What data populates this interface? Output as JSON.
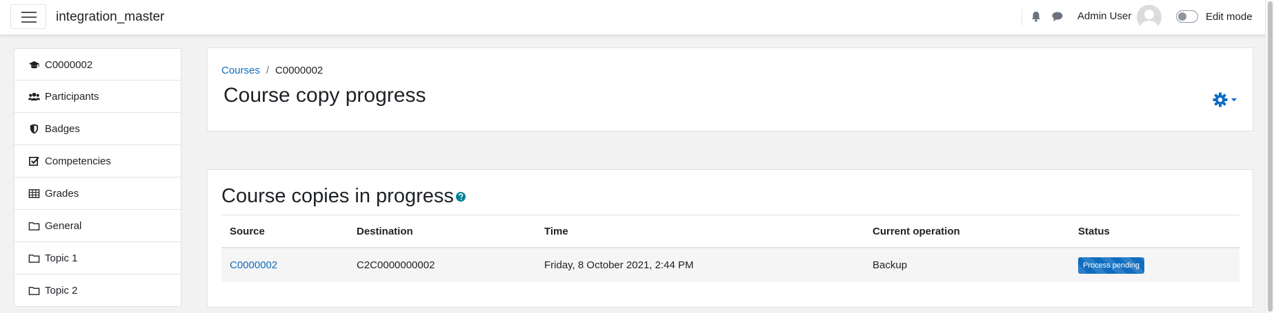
{
  "navbar": {
    "site_name": "integration_master",
    "user_name": "Admin User",
    "edit_mode_label": "Edit mode",
    "icons": [
      "bell-icon",
      "chat-icon"
    ]
  },
  "sidebar": {
    "items": [
      {
        "label": "C0000002",
        "icon": "graduation-cap-icon"
      },
      {
        "label": "Participants",
        "icon": "users-icon"
      },
      {
        "label": "Badges",
        "icon": "shield-icon"
      },
      {
        "label": "Competencies",
        "icon": "checkbox-icon"
      },
      {
        "label": "Grades",
        "icon": "table-icon"
      },
      {
        "label": "General",
        "icon": "folder-icon"
      },
      {
        "label": "Topic 1",
        "icon": "folder-icon"
      },
      {
        "label": "Topic 2",
        "icon": "folder-icon"
      }
    ]
  },
  "header": {
    "breadcrumb": [
      "Courses",
      "C0000002"
    ],
    "title": "Course copy progress"
  },
  "copies": {
    "title": "Course copies in progress",
    "columns": [
      "Source",
      "Destination",
      "Time",
      "Current operation",
      "Status"
    ],
    "rows": [
      {
        "source": "C0000002",
        "destination": "C2C0000000002",
        "time": "Friday, 8 October 2021, 2:44 PM",
        "operation": "Backup",
        "status": "Process pending"
      }
    ]
  },
  "colors": {
    "accent": "#0f6cbf",
    "background": "#f2f2f2",
    "help": "#008196"
  }
}
